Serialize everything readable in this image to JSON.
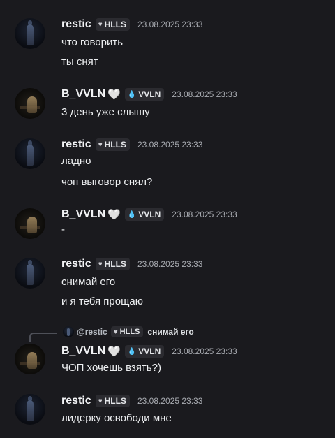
{
  "colors": {
    "background": "#1a1a1e",
    "text": "#eef0f2",
    "timestamp": "#a8abb1",
    "tag_bg": "#2b2b30"
  },
  "users": {
    "restic": {
      "name": "restic",
      "tag": "HLLS",
      "tag_icon": "heart-icon"
    },
    "vvln": {
      "name": "B_VVLN",
      "name_suffix": "🤍",
      "tag": "VVLN",
      "tag_icon": "water-drop-icon"
    }
  },
  "messages": [
    {
      "author": "restic",
      "time": "23.08.2025 23:33",
      "lines": [
        "что говорить",
        "ты снят"
      ]
    },
    {
      "author": "B_VVLN",
      "time": "23.08.2025 23:33",
      "lines": [
        "3 день уже слышу"
      ]
    },
    {
      "author": "restic",
      "time": "23.08.2025 23:33",
      "lines": [
        "ладно",
        "чоп выговор снял?"
      ]
    },
    {
      "author": "B_VVLN",
      "time": "23.08.2025 23:33",
      "lines": [
        "-"
      ]
    },
    {
      "author": "restic",
      "time": "23.08.2025 23:33",
      "lines": [
        "снимай его",
        "и я тебя прощаю"
      ]
    },
    {
      "author": "B_VVLN",
      "time": "23.08.2025 23:33",
      "lines": [
        "ЧОП хочешь взять?)"
      ],
      "reply": {
        "mention": "@restic",
        "tag": "HLLS",
        "text": "снимай его"
      }
    },
    {
      "author": "restic",
      "time": "23.08.2025 23:33",
      "lines": [
        "лидерку освободи мне"
      ]
    }
  ]
}
